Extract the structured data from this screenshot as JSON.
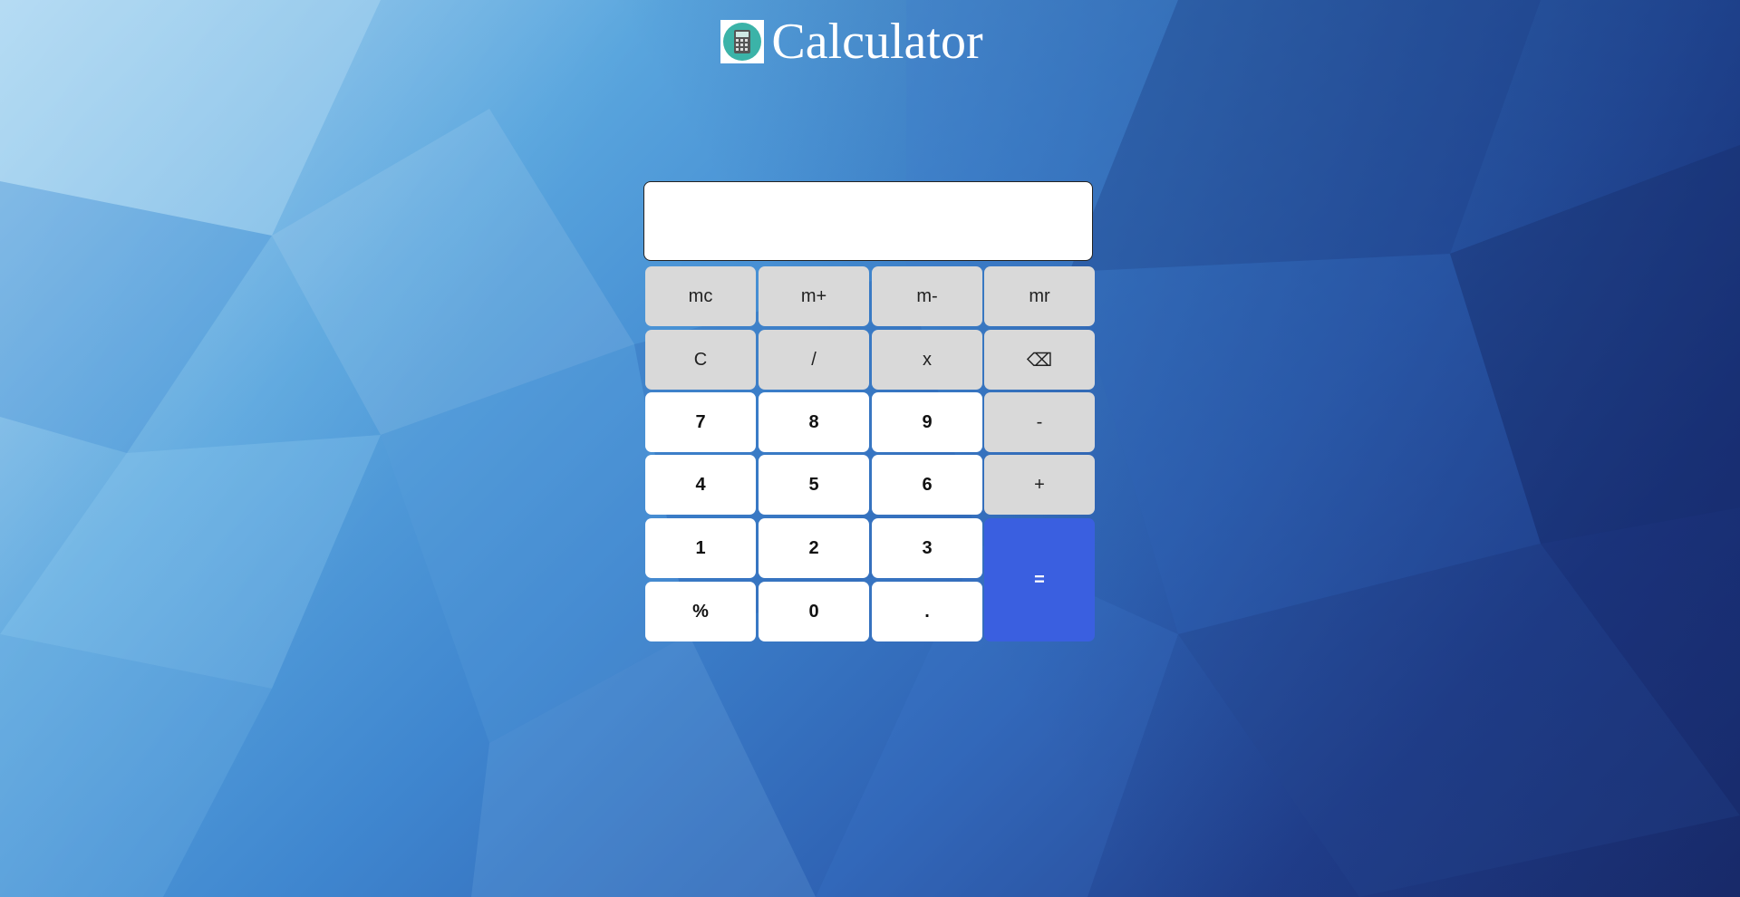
{
  "header": {
    "title": "Calculator",
    "logo_icon": "calculator-icon"
  },
  "display": {
    "value": "",
    "placeholder": ""
  },
  "colors": {
    "operator_key": "#d9d9d9",
    "number_key": "#ffffff",
    "equals_key": "#3a5fe0"
  },
  "keys": {
    "mc": "mc",
    "m_plus": "m+",
    "m_minus": "m-",
    "mr": "mr",
    "clear": "C",
    "divide": "/",
    "multiply": "x",
    "backspace": "⌫",
    "seven": "7",
    "eight": "8",
    "nine": "9",
    "minus": "-",
    "four": "4",
    "five": "5",
    "six": "6",
    "plus": "+",
    "one": "1",
    "two": "2",
    "three": "3",
    "equals": "=",
    "percent": "%",
    "zero": "0",
    "dot": "."
  }
}
